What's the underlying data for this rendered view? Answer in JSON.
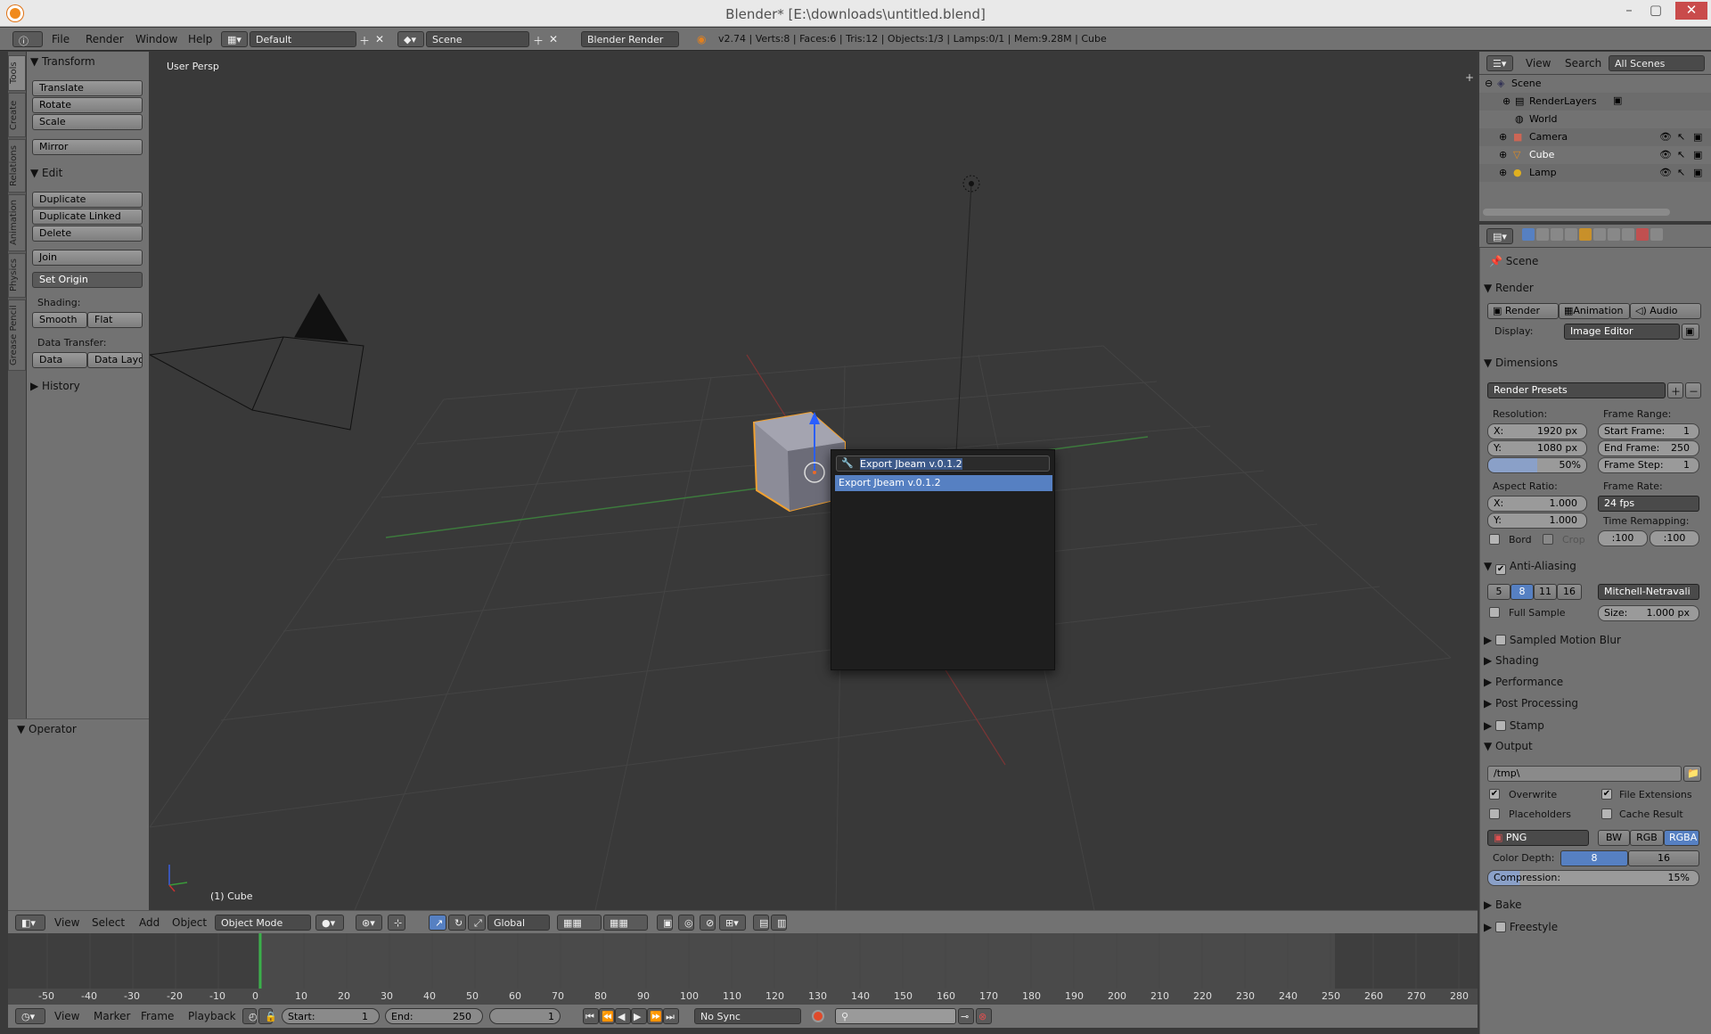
{
  "window": {
    "title": "Blender* [E:\\downloads\\untitled.blend]"
  },
  "infobar": {
    "menus": [
      "File",
      "Render",
      "Window",
      "Help"
    ],
    "layout": "Default",
    "scene": "Scene",
    "engine": "Blender Render",
    "stats": "v2.74 | Verts:8 | Faces:6 | Tris:12 | Objects:1/3 | Lamps:0/1 | Mem:9.28M | Cube"
  },
  "toolshelf": {
    "tabs": [
      "Tools",
      "Create",
      "Relations",
      "Animation",
      "Physics",
      "Grease Pencil"
    ],
    "transform": {
      "title": "Transform",
      "buttons": [
        "Translate",
        "Rotate",
        "Scale",
        "Mirror"
      ]
    },
    "edit": {
      "title": "Edit",
      "duplicate": "Duplicate",
      "duplicate_linked": "Duplicate Linked",
      "delete": "Delete",
      "join": "Join",
      "set_origin": "Set Origin",
      "shading_label": "Shading:",
      "smooth": "Smooth",
      "flat": "Flat",
      "data_transfer_label": "Data Transfer:",
      "data": "Data",
      "data_layo": "Data Layo"
    },
    "history": "History",
    "operator": "Operator"
  },
  "viewport": {
    "label": "User Persp",
    "object_label": "(1) Cube",
    "search_popup": {
      "query": "Export Jbeam v.0.1.2",
      "results": [
        "Export Jbeam v.0.1.2"
      ]
    }
  },
  "viewport_header": {
    "menus": [
      "View",
      "Select",
      "Add",
      "Object"
    ],
    "mode": "Object Mode",
    "orientation": "Global"
  },
  "timeline": {
    "ticks": [
      "-50",
      "-40",
      "-30",
      "-20",
      "-10",
      "0",
      "10",
      "20",
      "30",
      "40",
      "50",
      "60",
      "70",
      "80",
      "90",
      "100",
      "110",
      "120",
      "130",
      "140",
      "150",
      "160",
      "170",
      "180",
      "190",
      "200",
      "210",
      "220",
      "230",
      "240",
      "250",
      "260",
      "270",
      "280"
    ],
    "current_frame": 0
  },
  "timeline_header": {
    "menus": [
      "View",
      "Marker",
      "Frame",
      "Playback"
    ],
    "start_label": "Start:",
    "start": "1",
    "end_label": "End:",
    "end": "250",
    "current": "1",
    "sync": "No Sync"
  },
  "outliner": {
    "menus": [
      "View",
      "Search"
    ],
    "filter": "All Scenes",
    "items": [
      "Scene",
      "RenderLayers",
      "World",
      "Camera",
      "Cube",
      "Lamp"
    ]
  },
  "properties": {
    "context": "Scene",
    "render": {
      "title": "Render",
      "render_btn": "Render",
      "animation_btn": "Animation",
      "audio_btn": "Audio",
      "display_label": "Display:",
      "display": "Image Editor"
    },
    "dimensions": {
      "title": "Dimensions",
      "presets": "Render Presets",
      "resolution_label": "Resolution:",
      "res_x": "X:",
      "res_x_val": "1920 px",
      "res_y": "Y:",
      "res_y_val": "1080 px",
      "res_pct": "50%",
      "frame_range_label": "Frame Range:",
      "start_frame": "Start Frame:",
      "start_val": "1",
      "end_frame": "End Frame:",
      "end_val": "250",
      "frame_step": "Frame Step:",
      "step_val": "1",
      "aspect_label": "Aspect Ratio:",
      "asp_x": "X:",
      "asp_x_val": "1.000",
      "asp_y": "Y:",
      "asp_y_val": "1.000",
      "frame_rate_label": "Frame Rate:",
      "frame_rate": "24 fps",
      "time_remap_label": "Time Remapping:",
      "remap_old": ":100",
      "remap_new": ":100",
      "bord": "Bord",
      "crop": "Crop"
    },
    "antialiasing": {
      "title": "Anti-Aliasing",
      "samples": [
        "5",
        "8",
        "11",
        "16"
      ],
      "filter": "Mitchell-Netravali",
      "full_sample": "Full Sample",
      "size_label": "Size:",
      "size": "1.000 px"
    },
    "collapsed": [
      "Sampled Motion Blur",
      "Shading",
      "Performance",
      "Post Processing",
      "Stamp"
    ],
    "output": {
      "title": "Output",
      "path": "/tmp\\",
      "overwrite": "Overwrite",
      "file_extensions": "File Extensions",
      "placeholders": "Placeholders",
      "cache_result": "Cache Result",
      "format": "PNG",
      "bw": "BW",
      "rgb": "RGB",
      "rgba": "RGBA",
      "color_depth_label": "Color Depth:",
      "depth_8": "8",
      "depth_16": "16",
      "compression_label": "Compression:",
      "compression": "15%"
    },
    "bake": "Bake",
    "freestyle": "Freestyle"
  },
  "colors": {
    "accent": "#5680c2",
    "selected_outline": "#f0a030",
    "background": "#393939"
  }
}
